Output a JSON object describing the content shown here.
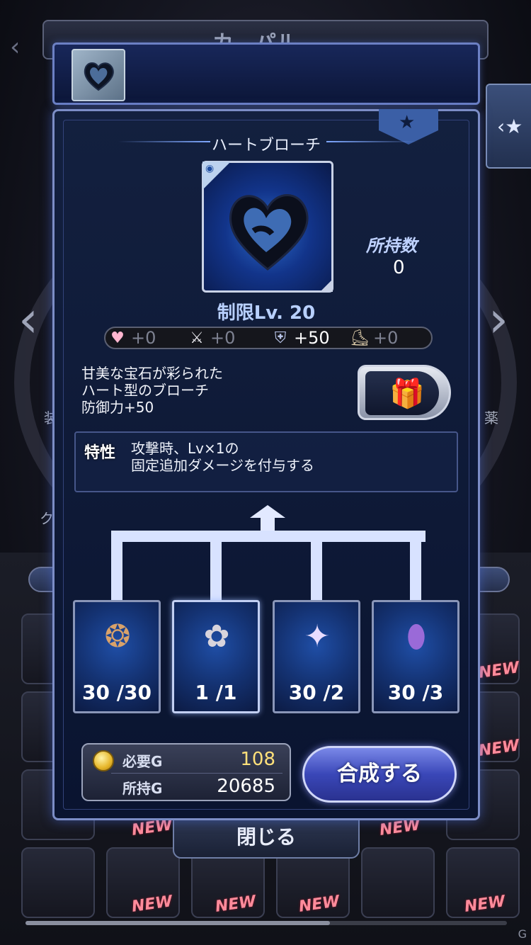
{
  "background": {
    "header_title": "カ　パル",
    "side_text_left": "装",
    "side_text_right": "薬",
    "side_text_left2": "ク",
    "new_badge": "NEW",
    "close_label": "閉じる"
  },
  "item": {
    "name": "ハートブローチ",
    "owned_label": "所持数",
    "owned_value": "0",
    "level_limit": "制限Lv. 20",
    "description": [
      "甘美な宝石が彩られた",
      "ハート型のブローチ",
      "防御力+50"
    ],
    "trait_label": "特性",
    "trait_text": [
      "攻撃時、Lv×1の",
      "固定追加ダメージを付与する"
    ]
  },
  "stats": [
    {
      "icon": "heart-icon",
      "value": "+0",
      "active": false
    },
    {
      "icon": "sword-icon",
      "value": "+0",
      "active": false
    },
    {
      "icon": "shield-icon",
      "value": "+50",
      "active": true
    },
    {
      "icon": "boot-icon",
      "value": "+0",
      "active": false
    }
  ],
  "materials": [
    {
      "icon": "ornate-medallion-icon",
      "count": "30 /30"
    },
    {
      "icon": "silver-flower-icon",
      "count": "1 /1"
    },
    {
      "icon": "crystal-shard-icon",
      "count": "30 /2"
    },
    {
      "icon": "violet-gem-icon",
      "count": "30 /3"
    }
  ],
  "cost": {
    "required_label": "必要G",
    "required_value": "108",
    "owned_label": "所持G",
    "owned_value": "20685"
  },
  "craft_button": "合成する",
  "watermark": "G"
}
